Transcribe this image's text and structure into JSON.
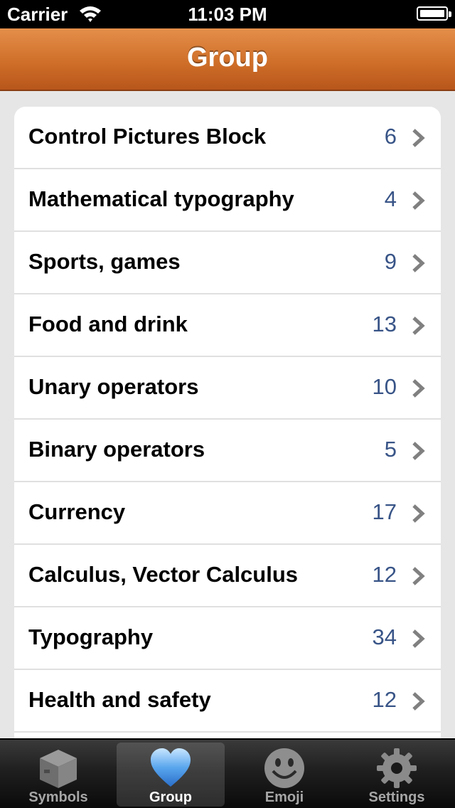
{
  "status_bar": {
    "carrier": "Carrier",
    "time": "11:03 PM"
  },
  "nav": {
    "title": "Group"
  },
  "rows": [
    {
      "label": "Control Pictures Block",
      "count": "6"
    },
    {
      "label": "Mathematical typography",
      "count": "4"
    },
    {
      "label": "Sports, games",
      "count": "9"
    },
    {
      "label": "Food and drink",
      "count": "13"
    },
    {
      "label": "Unary operators",
      "count": "10"
    },
    {
      "label": "Binary operators",
      "count": "5"
    },
    {
      "label": "Currency",
      "count": "17"
    },
    {
      "label": "Calculus, Vector Calculus",
      "count": "12"
    },
    {
      "label": "Typography",
      "count": "34"
    },
    {
      "label": "Health and safety",
      "count": "12"
    }
  ],
  "tabs": [
    {
      "label": "Symbols",
      "icon": "box-icon",
      "selected": false
    },
    {
      "label": "Group",
      "icon": "heart-icon",
      "selected": true
    },
    {
      "label": "Emoji",
      "icon": "smiley-icon",
      "selected": false
    },
    {
      "label": "Settings",
      "icon": "gear-icon",
      "selected": false
    }
  ],
  "colors": {
    "nav_orange": "#cf6f29",
    "count_blue": "#385487",
    "selected_tab_heart": "#5aa6ee"
  }
}
